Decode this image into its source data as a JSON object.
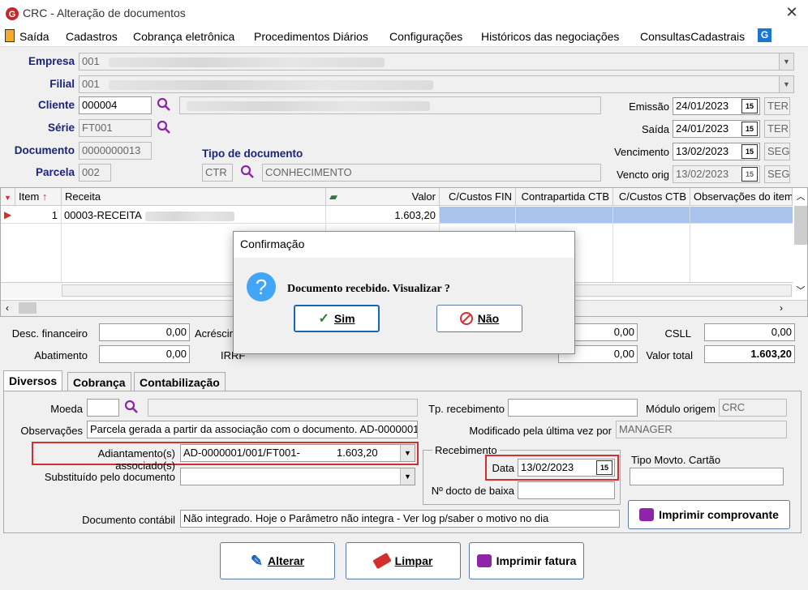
{
  "window": {
    "title": "CRC - Alteração de documentos"
  },
  "menu": [
    "Saída",
    "Cadastros",
    "Cobrança eletrônica",
    "Procedimentos Diários",
    "Configurações",
    "Históricos das negociações",
    "ConsultasCadastrais"
  ],
  "header": {
    "empresa_label": "Empresa",
    "empresa_code": "001",
    "filial_label": "Filial",
    "filial_code": "001",
    "cliente_label": "Cliente",
    "cliente_code": "000004",
    "serie_label": "Série",
    "serie_value": "FT001",
    "documento_label": "Documento",
    "documento_value": "0000000013",
    "parcela_label": "Parcela",
    "parcela_value": "002",
    "tipo_doc_label": "Tipo de documento",
    "tipo_doc_code": "CTR",
    "tipo_doc_name": "CONHECIMENTO",
    "emissao_label": "Emissão",
    "emissao_value": "24/01/2023",
    "emissao_day": "TER",
    "saida_label": "Saída",
    "saida_value": "24/01/2023",
    "saida_day": "TER",
    "vencimento_label": "Vencimento",
    "vencimento_value": "13/02/2023",
    "vencimento_day": "SEG",
    "vencto_orig_label": "Vencto orig",
    "vencto_orig_value": "13/02/2023",
    "vencto_orig_day": "SEG"
  },
  "grid": {
    "columns": [
      "Item",
      "Receita",
      "Valor",
      "C/Custos FIN",
      "Contrapartida CTB",
      "C/Custos CTB",
      "Observações do item"
    ],
    "rows": [
      {
        "item": "1",
        "receita": "00003-RECEITA",
        "valor": "1.603,20"
      }
    ]
  },
  "totals": {
    "desc_fin_label": "Desc. financeiro",
    "desc_fin_value": "0,00",
    "acresc_label": "Acréscim",
    "abatimento_label": "Abatimento",
    "abatimento_value": "0,00",
    "irrf_label": "IRRF",
    "mid1_value": "0,00",
    "mid2_value": "0,00",
    "csll_label": "CSLL",
    "csll_value": "0,00",
    "valor_total_label": "Valor total",
    "valor_total_value": "1.603,20"
  },
  "dialog": {
    "title": "Confirmação",
    "message": "Documento recebido. Visualizar ?",
    "yes_label": "Sim",
    "no_label": "Não"
  },
  "tabs": [
    "Diversos",
    "Cobrança",
    "Contabilização"
  ],
  "diversos": {
    "moeda_label": "Moeda",
    "observacoes_label": "Observações",
    "observacoes_value": "Parcela gerada a partir da associação com o documento. AD-0000001",
    "adiantamento_label": "Adiantamento(s) associado(s)",
    "adiantamento_value": "AD-0000001/001/FT001-",
    "adiantamento_amount": "1.603,20",
    "substituido_label": "Substituído pelo documento",
    "doc_contabil_label": "Documento contábil",
    "doc_contabil_value": "Não integrado. Hoje o Parâmetro não integra - Ver log p/saber o motivo no dia",
    "tp_recebimento_label": "Tp. recebimento",
    "modulo_origem_label": "Módulo origem",
    "modulo_origem_value": "CRC",
    "modificado_label": "Modificado pela última vez por",
    "modificado_value": "MANAGER",
    "recebimento_group": "Recebimento",
    "data_label": "Data",
    "data_value": "13/02/2023",
    "ndocto_label": "Nº docto de baixa",
    "tipo_movto_label": "Tipo Movto. Cartão",
    "imprimir_comprovante_label": "Imprimir comprovante"
  },
  "footer": {
    "alterar_label": "Alterar",
    "limpar_label": "Limpar",
    "imprimir_fatura_label": "Imprimir fatura"
  },
  "colors": {
    "label_blue": "#1a237e",
    "highlight": "#a8c4ec",
    "red": "#d32f2f"
  }
}
